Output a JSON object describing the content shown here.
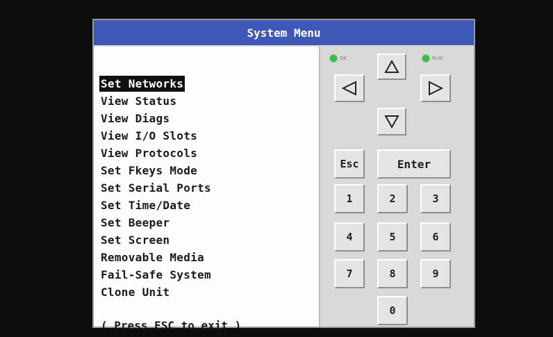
{
  "window": {
    "title": "System Menu"
  },
  "menu": {
    "items": [
      {
        "label": "Set Networks"
      },
      {
        "label": "View Status"
      },
      {
        "label": "View Diags"
      },
      {
        "label": "View I/O Slots"
      },
      {
        "label": "View Protocols"
      },
      {
        "label": "Set Fkeys Mode"
      },
      {
        "label": "Set Serial Ports"
      },
      {
        "label": "Set Time/Date"
      },
      {
        "label": "Set Beeper"
      },
      {
        "label": "Set Screen"
      },
      {
        "label": "Removable Media"
      },
      {
        "label": "Fail-Safe System"
      },
      {
        "label": "Clone Unit"
      }
    ],
    "selected_label": "Set Networks",
    "exit_hint": "( Press ESC to exit )"
  },
  "keypad": {
    "leds": [
      {
        "label": "OK",
        "color": "#2fc23b"
      },
      {
        "label": "RUN",
        "color": "#2fc23b"
      }
    ],
    "arrows": {
      "up_icon": "up-triangle-icon",
      "down_icon": "down-triangle-icon",
      "left_icon": "left-triangle-icon",
      "right_icon": "right-triangle-icon"
    },
    "esc_label": "Esc",
    "enter_label": "Enter",
    "digits": [
      "1",
      "2",
      "3",
      "4",
      "5",
      "6",
      "7",
      "8",
      "9",
      "0"
    ]
  },
  "colors": {
    "titlebar": "#3f58b8",
    "selection": "#111111",
    "led_green": "#2fc23b"
  }
}
